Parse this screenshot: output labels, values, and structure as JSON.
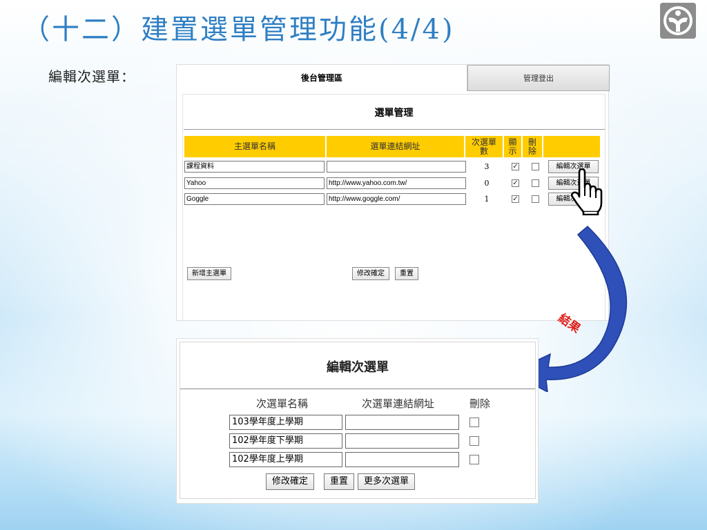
{
  "slide": {
    "title": "（十二）建置選單管理功能(4/4)",
    "subtitle": "編輯次選單："
  },
  "admin": {
    "area_title": "後台管理區",
    "logout_label": "管理登出",
    "panel_title": "選單管理",
    "headers": {
      "main_name": "主選單名稱",
      "link": "選單連結網址",
      "sub_count": "次選單數",
      "show": "顯示",
      "delete": "刪除"
    },
    "rows": [
      {
        "name": "課程資料",
        "url": "",
        "sub_count": "3",
        "show": true,
        "delete": false,
        "edit_label": "編輯次選單"
      },
      {
        "name": "Yahoo",
        "url": "http://www.yahoo.com.tw/",
        "sub_count": "0",
        "show": true,
        "delete": false,
        "edit_label": "編輯次選單"
      },
      {
        "name": "Goggle",
        "url": "http://www.goggle.com/",
        "sub_count": "1",
        "show": true,
        "delete": false,
        "edit_label": "編輯次選單"
      }
    ],
    "add_main_label": "新增主選單",
    "confirm_label": "修改確定",
    "reset_label": "重置"
  },
  "annotation": {
    "result_label": "結果",
    "arrow_color": "#2f50b8"
  },
  "result": {
    "title": "編輯次選單",
    "headers": {
      "name": "次選單名稱",
      "link": "次選單連結網址",
      "delete": "刪除"
    },
    "rows": [
      {
        "name": "103學年度上學期",
        "url": "",
        "delete": false
      },
      {
        "name": "102學年度下學期",
        "url": "",
        "delete": false
      },
      {
        "name": "102學年度上學期",
        "url": "",
        "delete": false
      }
    ],
    "confirm_label": "修改確定",
    "reset_label": "重置",
    "more_label": "更多次選單"
  }
}
